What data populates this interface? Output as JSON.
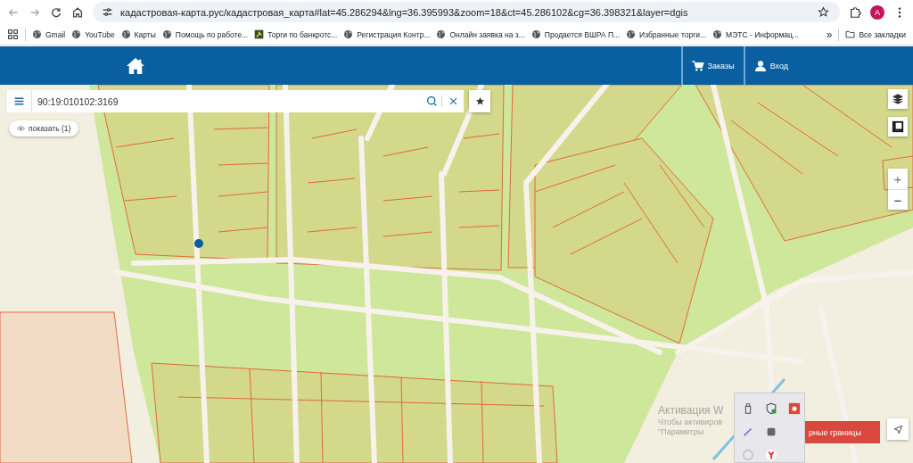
{
  "browser": {
    "url": "кадастровая-карта.рус/кадастровая_карта#lat=45.286294&lng=36.395993&zoom=18&ct=45.286102&cg=36.398321&layer=dgis",
    "avatar": "A",
    "bookmarks": [
      {
        "label": "Gmail",
        "kind": "globe"
      },
      {
        "label": "YouTube",
        "kind": "globe"
      },
      {
        "label": "Карты",
        "kind": "globe"
      },
      {
        "label": "Помощь по работе...",
        "kind": "globe"
      },
      {
        "label": "Торги по банкротс...",
        "kind": "image"
      },
      {
        "label": "Регистрация Контр...",
        "kind": "globe"
      },
      {
        "label": "Онлайн заявка на з...",
        "kind": "globe"
      },
      {
        "label": "Продается ВШРА П...",
        "kind": "globe"
      },
      {
        "label": "Избранные торги...",
        "kind": "globe"
      },
      {
        "label": "МЭТС - Информац...",
        "kind": "globe"
      }
    ],
    "more": "»",
    "all_bookmarks": "Все закладки"
  },
  "header": {
    "nav": [
      {
        "label": "Заказы",
        "kind": "cart"
      },
      {
        "label": "Вход",
        "kind": "user"
      }
    ]
  },
  "search": {
    "value": "90:19:010102:3169"
  },
  "show_button": "показать (1)",
  "zoom": [
    "+",
    "−"
  ],
  "borders_button": "рные границы",
  "windows_activation": [
    "Активация W",
    "Чтобы активиров",
    "\"Параметры"
  ]
}
